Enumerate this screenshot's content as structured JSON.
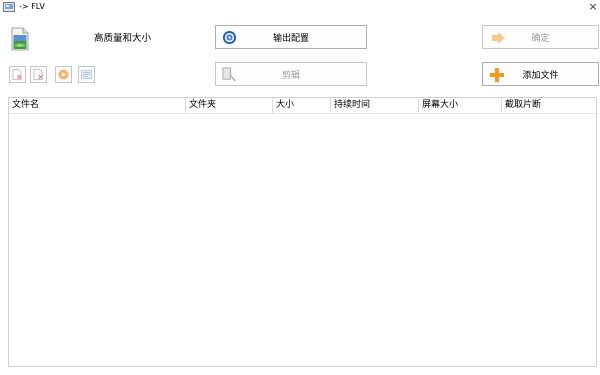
{
  "window": {
    "title": "-> FLV",
    "close_symbol": "×"
  },
  "settings": {
    "quality_label": "高质量和大小"
  },
  "buttons": {
    "output_config": "输出配置",
    "edit": "剪辑",
    "confirm": "确定",
    "add_file": "添加文件"
  },
  "toolbar": {
    "icons": [
      "add-item-icon",
      "remove-item-icon",
      "play-icon",
      "media-info-icon"
    ]
  },
  "file_list": {
    "columns": [
      "文件名",
      "文件夹",
      "大小",
      "持续时间",
      "屏幕大小",
      "截取片断"
    ],
    "rows": []
  },
  "colors": {
    "accent_orange": "#f39a1e",
    "disabled_text": "#9a9a9a",
    "border": "#adadad"
  }
}
